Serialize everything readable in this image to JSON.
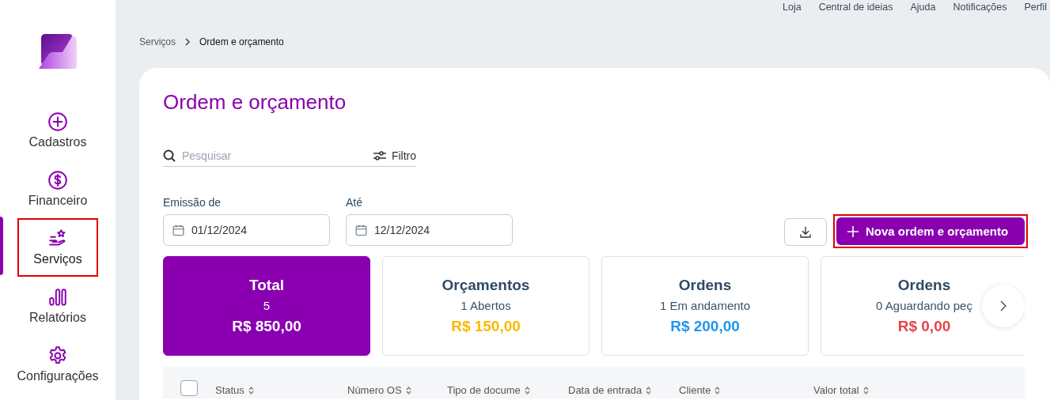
{
  "sidebar": {
    "items": [
      {
        "label": "Cadastros",
        "selected": false,
        "highlighted": false
      },
      {
        "label": "Financeiro",
        "selected": false,
        "highlighted": false
      },
      {
        "label": "Serviços",
        "selected": true,
        "highlighted": true
      },
      {
        "label": "Relatórios",
        "selected": false,
        "highlighted": false
      },
      {
        "label": "Configurações",
        "selected": false,
        "highlighted": false
      }
    ]
  },
  "top_links": [
    "Loja",
    "Central de ideias",
    "Ajuda",
    "Notificações",
    "Perfil"
  ],
  "breadcrumb": [
    "Serviços",
    "Ordem e orçamento"
  ],
  "page_title": "Ordem e orçamento",
  "search": {
    "placeholder": "Pesquisar"
  },
  "filter_button": "Filtro",
  "date_from": {
    "label": "Emissão de",
    "value": "01/12/2024"
  },
  "date_to": {
    "label": "Até",
    "value": "12/12/2024"
  },
  "new_button": {
    "label": "Nova ordem e orçamento",
    "highlighted": true
  },
  "summary_cards": [
    {
      "title": "Total",
      "subtitle": "5",
      "amount": "R$ 850,00",
      "selected": true,
      "color": "#ffffff"
    },
    {
      "title": "Orçamentos",
      "subtitle": "1 Abertos",
      "amount": "R$ 150,00",
      "selected": false,
      "color": "#fbb900"
    },
    {
      "title": "Ordens",
      "subtitle": "1 Em andamento",
      "amount": "R$ 200,00",
      "selected": false,
      "color": "#1e96f0"
    },
    {
      "title": "Ordens",
      "subtitle": "0 Aguardando peç",
      "amount": "R$ 0,00",
      "selected": false,
      "color": "#e8424a"
    }
  ],
  "table": {
    "select_all_checked": false,
    "columns": [
      "Status",
      "Número OS",
      "Tipo de docume",
      "Data de entrada",
      "Cliente",
      "Valor total"
    ]
  }
}
